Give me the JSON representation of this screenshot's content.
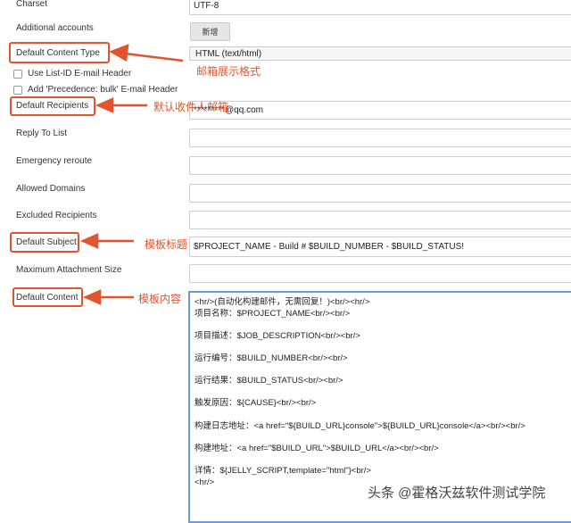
{
  "fields": {
    "charset": {
      "label": "Charset",
      "value": "UTF-8"
    },
    "additional_accounts": {
      "label": "Additional accounts",
      "button": "新增"
    },
    "content_type": {
      "label": "Default Content Type",
      "value": "HTML (text/html)"
    },
    "use_list_id": {
      "label": "Use List-ID E-mail Header"
    },
    "precedence": {
      "label": "Add 'Precedence: bulk' E-mail Header"
    },
    "recipients": {
      "label": "Default Recipients",
      "value": "*********@qq.com"
    },
    "reply_to": {
      "label": "Reply To List",
      "value": ""
    },
    "emergency": {
      "label": "Emergency reroute",
      "value": ""
    },
    "allowed_domains": {
      "label": "Allowed Domains",
      "value": ""
    },
    "excluded": {
      "label": "Excluded Recipients",
      "value": ""
    },
    "subject": {
      "label": "Default Subject",
      "value": "$PROJECT_NAME - Build # $BUILD_NUMBER - $BUILD_STATUS!"
    },
    "max_attach": {
      "label": "Maximum Attachment Size",
      "value": ""
    },
    "content": {
      "label": "Default Content",
      "value": "<hr/>(自动化构建邮件，无需回复！)<br/><hr/>\n项目名称：$PROJECT_NAME<br/><br/>\n\n项目描述：$JOB_DESCRIPTION<br/><br/>\n\n运行编号：$BUILD_NUMBER<br/><br/>\n\n运行结果：$BUILD_STATUS<br/><br/>\n\n触发原因：${CAUSE}<br/><br/>\n\n构建日志地址：<a href=\"${BUILD_URL}console\">${BUILD_URL}console</a><br/><br/>\n\n构建地址：<a href=\"$BUILD_URL\">$BUILD_URL</a><br/><br/>\n\n详情：${JELLY_SCRIPT,template=\"html\"}<br/>\n<hr/>"
    }
  },
  "annotations": {
    "content_type": "邮箱展示格式",
    "recipients": "默认收件人邮箱",
    "subject": "模板标题",
    "content": "模板内容"
  },
  "watermark": "头条 @霍格沃兹软件测试学院",
  "colors": {
    "annotation": "#e0552e",
    "focus": "#6b9bd8"
  }
}
